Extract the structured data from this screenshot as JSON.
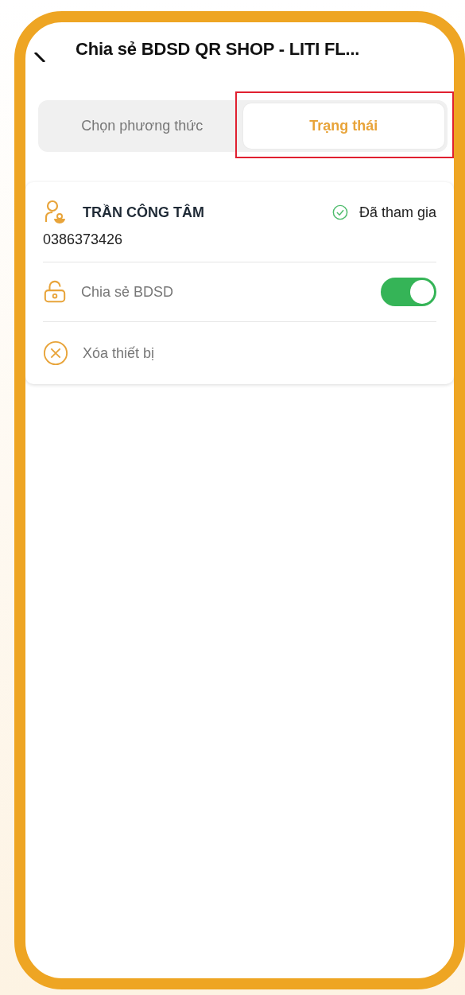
{
  "header": {
    "title": "Chia sẻ BDSD QR SHOP - LITI FL..."
  },
  "tabs": [
    {
      "label": "Chọn phương thức",
      "selected": false,
      "highlighted": false
    },
    {
      "label": "Trạng thái",
      "selected": true,
      "highlighted": true
    }
  ],
  "member": {
    "name": "TRẦN CÔNG TÂM",
    "status": "Đã tham gia",
    "phone": "0386373426",
    "rows": [
      {
        "kind": "toggle",
        "label": "Chia sẻ BDSD",
        "on": true
      },
      {
        "kind": "action",
        "label": "Xóa thiết bị"
      }
    ]
  }
}
